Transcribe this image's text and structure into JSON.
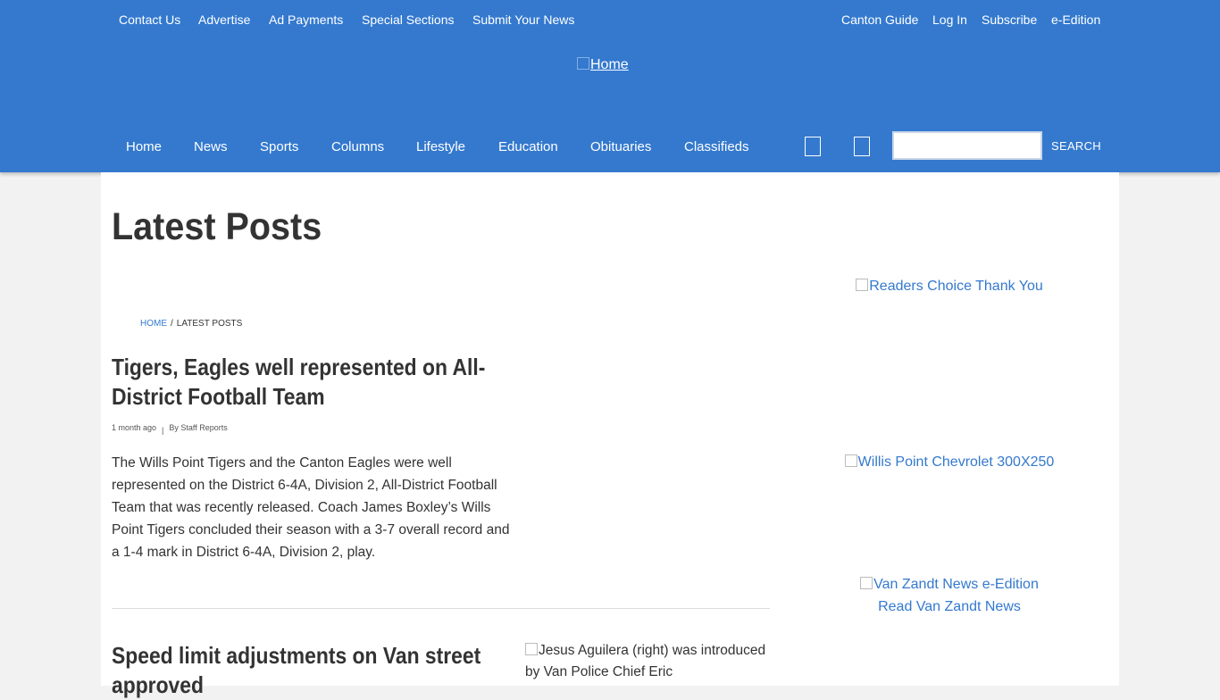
{
  "top_nav": {
    "left": [
      "Contact Us",
      "Advertise",
      "Ad Payments",
      "Special Sections",
      "Submit Your News"
    ],
    "right": [
      "Canton Guide",
      "Log In",
      "Subscribe",
      "e-Edition"
    ]
  },
  "logo": {
    "alt": "Home"
  },
  "main_nav": [
    "Home",
    "News",
    "Sports",
    "Columns",
    "Lifestyle",
    "Education",
    "Obituaries",
    "Classifieds"
  ],
  "search": {
    "button_label": "SEARCH",
    "value": ""
  },
  "page": {
    "title": "Latest Posts"
  },
  "breadcrumb": {
    "home": "HOME",
    "separator": "/",
    "current": "LATEST POSTS"
  },
  "posts": [
    {
      "title": "Tigers, Eagles well represented on All-District Football Team",
      "time": "1 month ago",
      "separator": "|",
      "author": "By Staff Reports",
      "excerpt": "The Wills Point Tigers and the Canton Eagles were well represented on the District 6-4A, Division 2, All-District Football Team that was recently released. Coach James Boxley’s Wills Point Tigers concluded their season with a 3-7 overall record and a 1-4 mark in District 6-4A, Division 2, play."
    },
    {
      "title": "Speed limit adjustments on Van street approved",
      "image_alt": "Jesus Aguilera (right) was introduced by Van Police Chief Eric"
    }
  ],
  "sidebar": {
    "ads": [
      {
        "alt": "Readers Choice Thank You"
      },
      {
        "alt": "Willis Point Chevrolet 300X250"
      },
      {
        "alt": "Van Zandt News e-Edition",
        "caption": "Read Van Zandt News"
      }
    ]
  },
  "colors": {
    "header_bg": "#3479ce",
    "link": "#3479ce",
    "page_bg": "#f2f2f2"
  }
}
